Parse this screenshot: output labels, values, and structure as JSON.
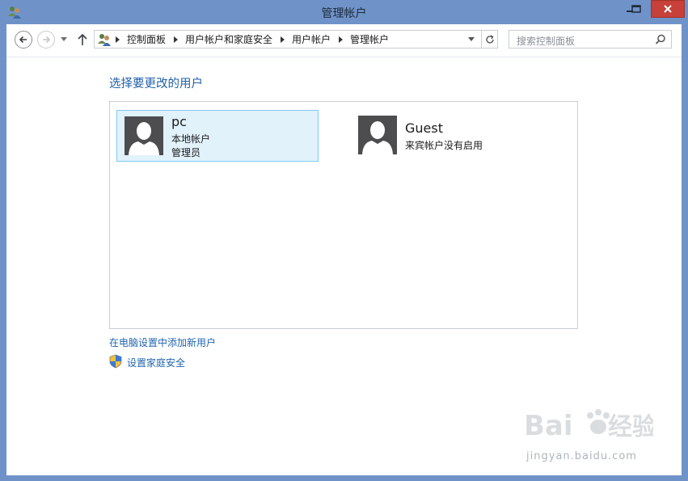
{
  "window": {
    "title": "管理帐户"
  },
  "nav": {
    "breadcrumbs": [
      "控制面板",
      "用户帐户和家庭安全",
      "用户帐户",
      "管理帐户"
    ],
    "search_placeholder": "搜索控制面板"
  },
  "main": {
    "heading": "选择要更改的用户",
    "accounts": [
      {
        "name": "pc",
        "details": [
          "本地帐户",
          "管理员"
        ],
        "selected": true
      },
      {
        "name": "Guest",
        "details": [
          "来宾帐户没有启用"
        ],
        "selected": false
      }
    ],
    "links": {
      "add_user": "在电脑设置中添加新用户",
      "family_safety": "设置家庭安全"
    }
  },
  "watermark": {
    "brand": "Bai du 经验",
    "url": "jingyan.baidu.com"
  },
  "colors": {
    "titlebar": "#6f93c9",
    "close_button": "#c7403a",
    "link": "#1f64ad",
    "heading": "#1f5fa8",
    "selected_tile": "#e1f2fb",
    "selected_border": "#7ec9ee",
    "avatar_bg": "#4d4d4f"
  }
}
